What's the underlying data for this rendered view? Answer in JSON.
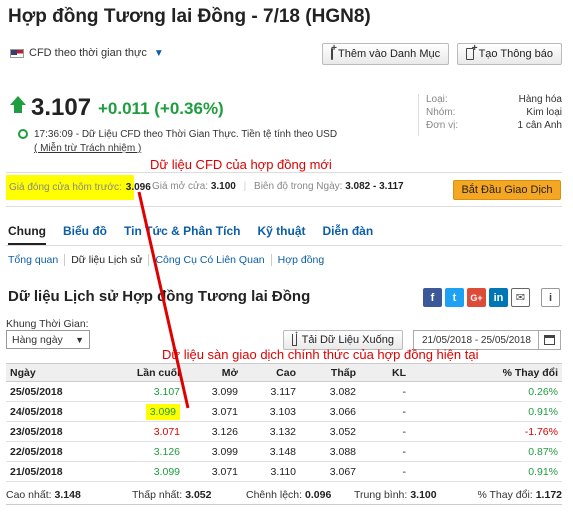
{
  "header": {
    "title": "Hợp đồng Tương lai Đồng - 7/18 (HGN8)",
    "cfd_label": "CFD theo thời gian thực",
    "add_watchlist": "Thêm vào Danh Mục",
    "create_alert": "Tạo Thông báo"
  },
  "quote": {
    "price": "3.107",
    "change": "+0.011",
    "change_pct": "(+0.36%)",
    "time_note": "17:36:09 - Dữ Liệu CFD theo Thời Gian Thực. Tiền tệ tính theo USD",
    "disclaimer": "( Miễn trừ Trách nhiệm )"
  },
  "info": [
    {
      "label": "Loại:",
      "value": "Hàng hóa"
    },
    {
      "label": "Nhóm:",
      "value": "Kim loại"
    },
    {
      "label": "Đơn vị:",
      "value": "1 cân Anh"
    }
  ],
  "annotations": {
    "cfd_note": "Dữ liệu CFD của hợp đồng mới",
    "official_note": "Dữ liệu sàn giao dịch chính thức của hợp đồng hiện tại"
  },
  "stats": {
    "prev_close_label": "Giá đóng cửa hôm trước:",
    "prev_close": "3.096",
    "open_label": "Giá mở cửa:",
    "open": "3.100",
    "range_label": "Biên độ trong Ngày:",
    "range": "3.082 - 3.117",
    "trade_button": "Bắt Đầu Giao Dịch"
  },
  "tabs": [
    "Chung",
    "Biểu đồ",
    "Tin Tức & Phân Tích",
    "Kỹ thuật",
    "Diễn đàn"
  ],
  "subtabs": [
    "Tổng quan",
    "Dữ liệu Lịch sử",
    "Công Cụ Có Liên Quan",
    "Hợp đồng"
  ],
  "history": {
    "title": "Dữ liệu Lịch sử Hợp đồng Tương lai Đồng",
    "timeframe_label": "Khung Thời Gian:",
    "timeframe_value": "Hàng ngày",
    "download": "Tải Dữ Liệu Xuống",
    "date_range": "21/05/2018 - 25/05/2018",
    "columns": [
      "Ngày",
      "Lần cuối",
      "Mở",
      "Cao",
      "Thấp",
      "KL",
      "% Thay đổi"
    ],
    "rows": [
      {
        "date": "25/05/2018",
        "last": "3.107",
        "open": "3.099",
        "high": "3.117",
        "low": "3.082",
        "vol": "-",
        "chg": "0.26%",
        "dir": "up"
      },
      {
        "date": "24/05/2018",
        "last": "3.099",
        "open": "3.071",
        "high": "3.103",
        "low": "3.066",
        "vol": "-",
        "chg": "0.91%",
        "dir": "up"
      },
      {
        "date": "23/05/2018",
        "last": "3.071",
        "open": "3.126",
        "high": "3.132",
        "low": "3.052",
        "vol": "-",
        "chg": "-1.76%",
        "dir": "down"
      },
      {
        "date": "22/05/2018",
        "last": "3.126",
        "open": "3.099",
        "high": "3.148",
        "low": "3.088",
        "vol": "-",
        "chg": "0.87%",
        "dir": "up"
      },
      {
        "date": "21/05/2018",
        "last": "3.099",
        "open": "3.071",
        "high": "3.110",
        "low": "3.067",
        "vol": "-",
        "chg": "0.91%",
        "dir": "up"
      }
    ],
    "summary": {
      "high_label": "Cao nhất:",
      "high": "3.148",
      "low_label": "Thấp nhất:",
      "low": "3.052",
      "diff_label": "Chênh lệch:",
      "diff": "0.096",
      "avg_label": "Trung bình:",
      "avg": "3.100",
      "chg_label": "% Thay đổi:",
      "chg": "1.172"
    }
  },
  "colors": {
    "up": "#1e9e3e",
    "down": "#e00000",
    "highlight": "#ffff00",
    "annotation": "#e00000"
  }
}
